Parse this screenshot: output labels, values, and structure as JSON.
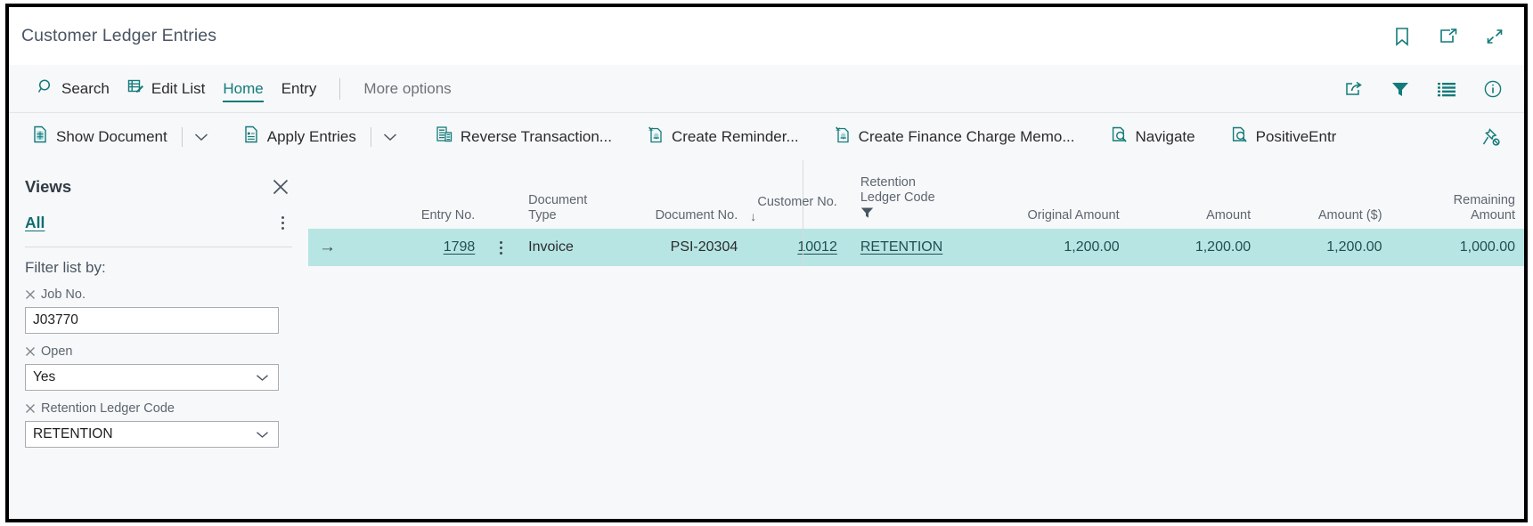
{
  "window": {
    "title": "Customer Ledger Entries",
    "titlebar_icons": [
      {
        "name": "bookmark-icon",
        "label": "Bookmark"
      },
      {
        "name": "open-in-new-window-icon",
        "label": "Open in new window"
      },
      {
        "name": "collapse-icon",
        "label": "Collapse"
      }
    ]
  },
  "ribbon": {
    "items": [
      {
        "name": "search",
        "label": "Search",
        "icon": "search-icon",
        "state": "normal"
      },
      {
        "name": "edit-list",
        "label": "Edit List",
        "icon": "edit-list-icon",
        "state": "normal"
      },
      {
        "name": "home",
        "label": "Home",
        "icon": null,
        "state": "active"
      },
      {
        "name": "entry",
        "label": "Entry",
        "icon": null,
        "state": "normal"
      },
      {
        "name": "more-options",
        "label": "More options",
        "icon": null,
        "state": "muted"
      }
    ],
    "right_icons": [
      {
        "name": "share-icon",
        "label": "Share"
      },
      {
        "name": "filter-icon",
        "label": "Filter"
      },
      {
        "name": "list-icon",
        "label": "List view"
      },
      {
        "name": "info-icon",
        "label": "Details"
      }
    ]
  },
  "actions": [
    {
      "name": "show-document",
      "label": "Show Document",
      "icon": "document-icon",
      "has_caret": true
    },
    {
      "name": "apply-entries",
      "label": "Apply Entries",
      "icon": "apply-entries-icon",
      "has_caret": true
    },
    {
      "name": "reverse-transaction",
      "label": "Reverse Transaction...",
      "icon": "reverse-transaction-icon",
      "has_caret": false
    },
    {
      "name": "create-reminder",
      "label": "Create Reminder...",
      "icon": "create-reminder-icon",
      "has_caret": false
    },
    {
      "name": "create-finance-charge-memo",
      "label": "Create Finance Charge Memo...",
      "icon": "create-finance-charge-memo-icon",
      "has_caret": false
    },
    {
      "name": "navigate",
      "label": "Navigate",
      "icon": "navigate-icon",
      "has_caret": false
    },
    {
      "name": "positive-entr",
      "label": "PositiveEntr",
      "icon": "navigate-icon",
      "has_caret": false
    }
  ],
  "action_bar_right": {
    "name": "unpin-icon",
    "label": "Unpin"
  },
  "views": {
    "title": "Views",
    "close_label": "Close",
    "more_label": "More options",
    "all_label": "All",
    "filter_list_by_label": "Filter list by:",
    "filters": [
      {
        "name": "job-no",
        "caption": "Job No.",
        "value": "J03770",
        "type": "text"
      },
      {
        "name": "open",
        "caption": "Open",
        "value": "Yes",
        "type": "select"
      },
      {
        "name": "retention-ledger-code",
        "caption": "Retention Ledger Code",
        "value": "RETENTION",
        "type": "select"
      }
    ]
  },
  "grid": {
    "columns": [
      {
        "name": "entry-no",
        "header": "Entry No.",
        "align": "right",
        "sort": null,
        "filtered": false
      },
      {
        "name": "document-type",
        "header": "Document\nType",
        "align": "left",
        "sort": null,
        "filtered": false
      },
      {
        "name": "document-no",
        "header": "Document No.",
        "align": "right",
        "sort": null,
        "filtered": false
      },
      {
        "name": "customer-no",
        "header": "Customer No.",
        "align": "right",
        "sort": "asc",
        "filtered": false
      },
      {
        "name": "retention-ledger-code",
        "header": "Retention\nLedger Code",
        "align": "left",
        "sort": null,
        "filtered": true
      },
      {
        "name": "original-amount",
        "header": "Original Amount",
        "align": "right",
        "sort": null,
        "filtered": false
      },
      {
        "name": "amount",
        "header": "Amount",
        "align": "right",
        "sort": null,
        "filtered": false
      },
      {
        "name": "amount-usd",
        "header": "Amount ($)",
        "align": "right",
        "sort": null,
        "filtered": false
      },
      {
        "name": "remaining-amount",
        "header": "Remaining\nAmount",
        "align": "right",
        "sort": null,
        "filtered": false
      }
    ],
    "header_lines": {
      "document_type_l1": "Document",
      "document_type_l2": "Type",
      "entry_no": "Entry No.",
      "document_no": "Document No.",
      "customer_no": "Customer No.",
      "sort_arrow": "↓",
      "retention_l1": "Retention",
      "retention_l2": "Ledger Code",
      "original_amount": "Original Amount",
      "amount": "Amount",
      "amount_usd": "Amount ($)",
      "remaining_l1": "Remaining",
      "remaining_l2": "Amount"
    },
    "rows": [
      {
        "selected": true,
        "row_indicator": "→",
        "entry_no": "1798",
        "document_type": "Invoice",
        "document_no": "PSI-20304",
        "customer_no": "10012",
        "retention_ledger_code": "RETENTION",
        "original_amount": "1,200.00",
        "amount": "1,200.00",
        "amount_usd": "1,200.00",
        "remaining_amount": "1,000.00"
      }
    ]
  },
  "annotation": {
    "name": "remaining-amount-highlight",
    "color": "#ff0000"
  },
  "colors": {
    "accent": "#137a7a",
    "selected_row": "#b7e5e4",
    "link": "#1f4f52",
    "chrome": "#f7f8f9"
  },
  "clipped_sliver": "  "
}
